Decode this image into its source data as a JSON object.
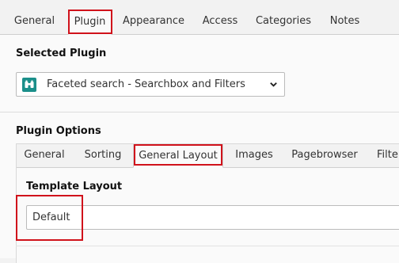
{
  "top_tabs": [
    "General",
    "Plugin",
    "Appearance",
    "Access",
    "Categories",
    "Notes"
  ],
  "active_top_tab": "Plugin",
  "selected_plugin": {
    "heading": "Selected Plugin",
    "value": "Faceted search - Searchbox and Filters",
    "icon": "binoculars-icon"
  },
  "plugin_options": {
    "heading": "Plugin Options",
    "tabs": [
      "General",
      "Sorting",
      "General Layout",
      "Images",
      "Pagebrowser",
      "Filter"
    ],
    "active_tab": "General Layout"
  },
  "template_layout": {
    "label": "Template Layout",
    "value": "Default"
  },
  "colors": {
    "highlight": "#d0121b",
    "icon_bg": "#1b8f8a"
  }
}
